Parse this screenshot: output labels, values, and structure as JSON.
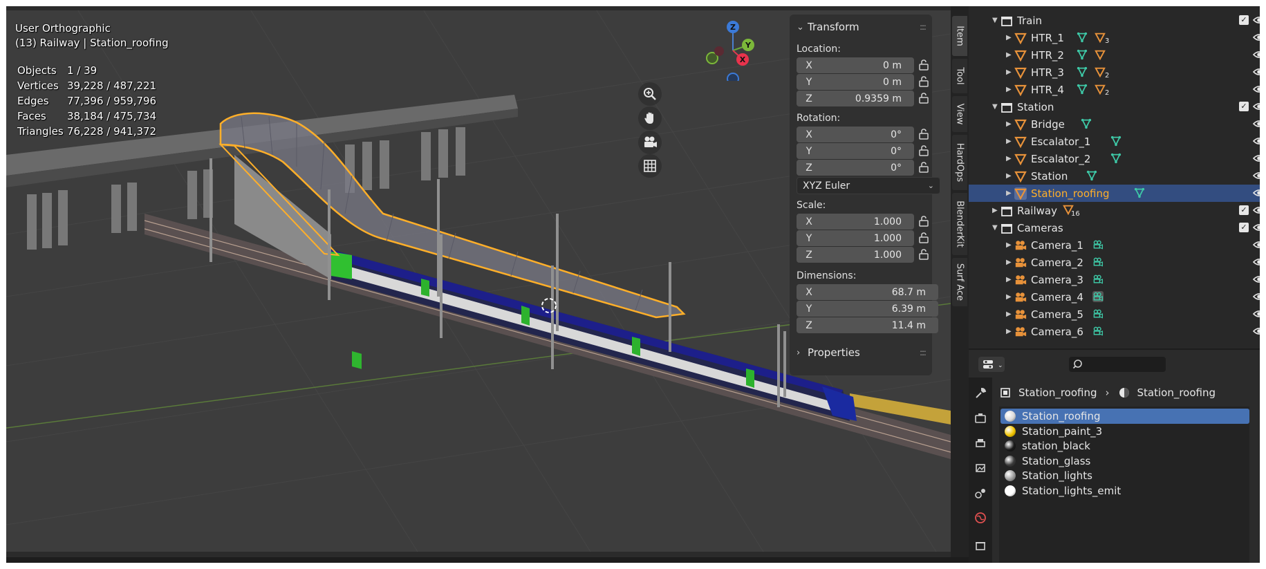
{
  "viewport": {
    "view_name": "User Orthographic",
    "context": "(13) Railway | Station_roofing",
    "stats": [
      {
        "label": "Objects",
        "value": "1 / 39"
      },
      {
        "label": "Vertices",
        "value": "39,228 / 487,221"
      },
      {
        "label": "Edges",
        "value": "77,396 / 959,796"
      },
      {
        "label": "Faces",
        "value": "38,184 / 475,734"
      },
      {
        "label": "Triangles",
        "value": "76,228 / 941,372"
      }
    ],
    "gizmo": {
      "z": "Z",
      "y": "Y",
      "x": "X"
    },
    "nav_icons": [
      "zoom-icon",
      "pan-hand-icon",
      "camera-view-icon",
      "grid-toggle-icon"
    ]
  },
  "npanel": {
    "transform": {
      "header": "Transform",
      "location_label": "Location:",
      "location": [
        {
          "axis": "X",
          "value": "0 m"
        },
        {
          "axis": "Y",
          "value": "0 m"
        },
        {
          "axis": "Z",
          "value": "0.9359 m"
        }
      ],
      "rotation_label": "Rotation:",
      "rotation": [
        {
          "axis": "X",
          "value": "0°"
        },
        {
          "axis": "Y",
          "value": "0°"
        },
        {
          "axis": "Z",
          "value": "0°"
        }
      ],
      "rotation_mode": "XYZ Euler",
      "scale_label": "Scale:",
      "scale": [
        {
          "axis": "X",
          "value": "1.000"
        },
        {
          "axis": "Y",
          "value": "1.000"
        },
        {
          "axis": "Z",
          "value": "1.000"
        }
      ],
      "dimensions_label": "Dimensions:",
      "dimensions": [
        {
          "axis": "X",
          "value": "68.7 m"
        },
        {
          "axis": "Y",
          "value": "6.39 m"
        },
        {
          "axis": "Z",
          "value": "11.4 m"
        }
      ]
    },
    "properties_header": "Properties"
  },
  "vtabs": [
    "Item",
    "Tool",
    "View",
    "HardOps",
    "BlenderKit",
    "Surf Ace"
  ],
  "outliner": {
    "rows": [
      {
        "label": "Train",
        "kind": "collection",
        "check": true
      },
      {
        "label": "HTR_1",
        "kind": "object",
        "sub": "3"
      },
      {
        "label": "HTR_2",
        "kind": "object",
        "sub": ""
      },
      {
        "label": "HTR_3",
        "kind": "object",
        "sub": "2"
      },
      {
        "label": "HTR_4",
        "kind": "object",
        "sub": "2"
      },
      {
        "label": "Station",
        "kind": "collection",
        "check": true
      },
      {
        "label": "Bridge",
        "kind": "object"
      },
      {
        "label": "Escalator_1",
        "kind": "object"
      },
      {
        "label": "Escalator_2",
        "kind": "object"
      },
      {
        "label": "Station",
        "kind": "object"
      },
      {
        "label": "Station_roofing",
        "kind": "object",
        "selected": true
      },
      {
        "label": "Railway",
        "kind": "collection",
        "check": true,
        "sub": "16"
      },
      {
        "label": "Cameras",
        "kind": "collection",
        "check": true
      },
      {
        "label": "Camera_1",
        "kind": "camera"
      },
      {
        "label": "Camera_2",
        "kind": "camera"
      },
      {
        "label": "Camera_3",
        "kind": "camera"
      },
      {
        "label": "Camera_4",
        "kind": "camera"
      },
      {
        "label": "Camera_5",
        "kind": "camera"
      },
      {
        "label": "Camera_6",
        "kind": "camera"
      }
    ]
  },
  "properties": {
    "breadcrumb": [
      "Station_roofing",
      "Station_roofing"
    ],
    "materials": [
      {
        "name": "Station_roofing",
        "color": "#d9d9d9",
        "selected": true
      },
      {
        "name": "Station_paint_3",
        "color": "#f2c500"
      },
      {
        "name": "station_black",
        "color": "#1a1a1a"
      },
      {
        "name": "Station_glass",
        "color": "#3a3a3a"
      },
      {
        "name": "Station_lights",
        "color": "#9a9a9a"
      },
      {
        "name": "Station_lights_emit",
        "color": "#ffffff"
      }
    ]
  },
  "colors": {
    "selection_orange": "#ffaf29",
    "selected_row": "#334d80",
    "selected_material": "#4772b3",
    "mesh_icon": "#e8923a",
    "data_icon": "#3ec9a7"
  }
}
